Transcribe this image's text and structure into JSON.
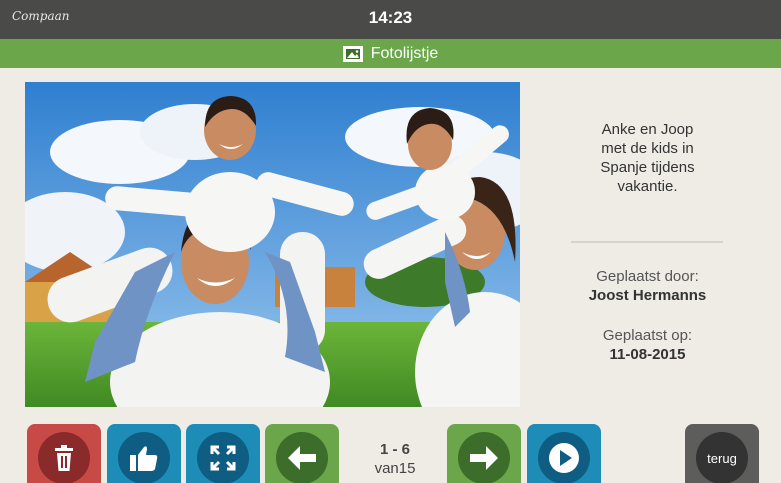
{
  "status": {
    "brand": "Compaan",
    "time": "14:23"
  },
  "header": {
    "title": "Fotolijstje",
    "icon": "photo-icon"
  },
  "photo": {
    "alt": "Familie in het gras"
  },
  "caption": {
    "line1": "Anke en Joop",
    "line2": "met de kids in",
    "line3": "Spanje tijdens",
    "line4": "vakantie."
  },
  "meta": {
    "posted_by_label": "Geplaatst door:",
    "posted_by": "Joost Hermanns",
    "posted_on_label": "Geplaatst op:",
    "posted_on": "11-08-2015"
  },
  "toolbar": {
    "delete_icon": "trash-icon",
    "like_icon": "thumbs-up-icon",
    "fullscreen_icon": "expand-icon",
    "prev_icon": "arrow-left-icon",
    "next_icon": "arrow-right-icon",
    "play_icon": "play-icon",
    "back_label": "terug"
  },
  "pager": {
    "range": "1 - 6",
    "total": "van15"
  },
  "colors": {
    "green": "#6ba64a",
    "blue": "#1d8db8",
    "red": "#c84a46",
    "dark": "#4a4a48"
  }
}
